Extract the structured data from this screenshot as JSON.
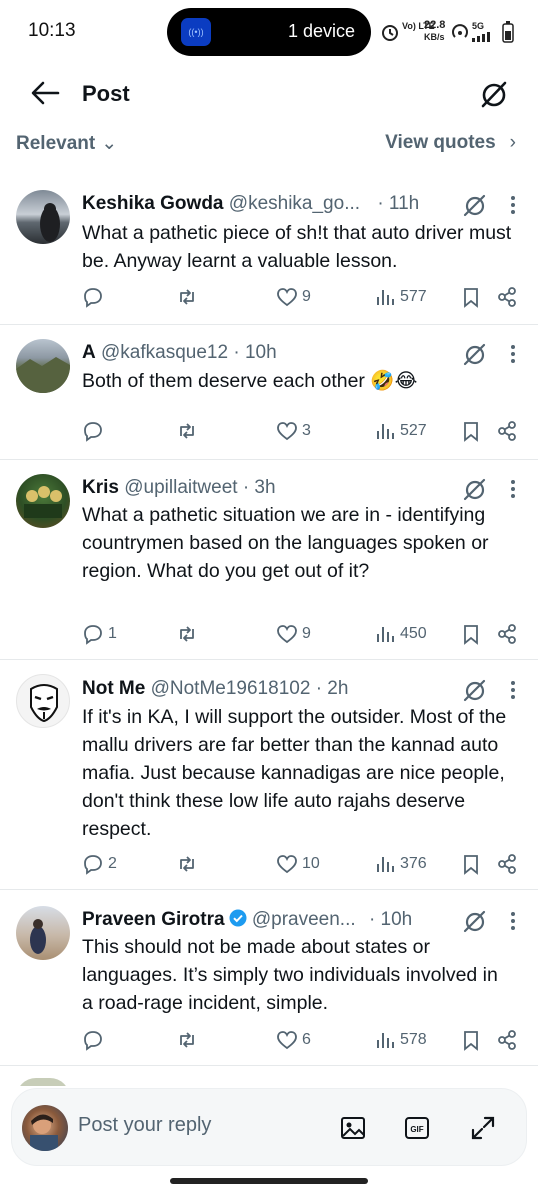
{
  "status_bar": {
    "time": "10:13",
    "island_text": "1 device",
    "network_speed": "22.8",
    "network_unit": "KB/s",
    "lte_label": "Vo) LTE",
    "signal_label": "5G"
  },
  "header": {
    "title": "Post"
  },
  "filters": {
    "sort_label": "Relevant",
    "quotes_label": "View quotes"
  },
  "tweets": [
    {
      "name": "Keshika Gowda",
      "handle": "@keshika_go...",
      "time": "· 11h",
      "verified": false,
      "text": "What a pathetic piece of sh!t that auto driver must be. Anyway learnt a valuable lesson.",
      "replies": "",
      "reposts": "",
      "likes": "9",
      "views": "577"
    },
    {
      "name": "A",
      "handle": "@kafkasque12",
      "time": "· 10h",
      "verified": false,
      "text": "Both of them deserve each other 🤣😂",
      "replies": "",
      "reposts": "",
      "likes": "3",
      "views": "527"
    },
    {
      "name": "Kris",
      "handle": "@upillaitweet",
      "time": "· 3h",
      "verified": false,
      "text": "What a pathetic situation we are in - identifying countrymen based on the languages spoken or region. What do you get out of it?",
      "replies": "1",
      "reposts": "",
      "likes": "9",
      "views": "450"
    },
    {
      "name": "Not Me",
      "handle": "@NotMe19618102",
      "time": "· 2h",
      "verified": false,
      "text": "If it's in KA, I will support the outsider. Most of the mallu drivers are far better than the kannad auto mafia. Just because kannadigas are nice people, don't think these low life auto rajahs deserve respect.",
      "replies": "2",
      "reposts": "",
      "likes": "10",
      "views": "376"
    },
    {
      "name": "Praveen Girotra",
      "handle": "@praveen...",
      "time": "· 10h",
      "verified": true,
      "text": "This should not be made about states or languages. It’s simply two individuals involved in a road-rage incident, simple.",
      "replies": "",
      "reposts": "",
      "likes": "6",
      "views": "578"
    }
  ],
  "reply_bar": {
    "placeholder": "Post your reply"
  },
  "colors": {
    "text": "#0f1419",
    "muted": "#536471",
    "verified_blue": "#1d9bf0",
    "divider": "#e6e9eb"
  }
}
